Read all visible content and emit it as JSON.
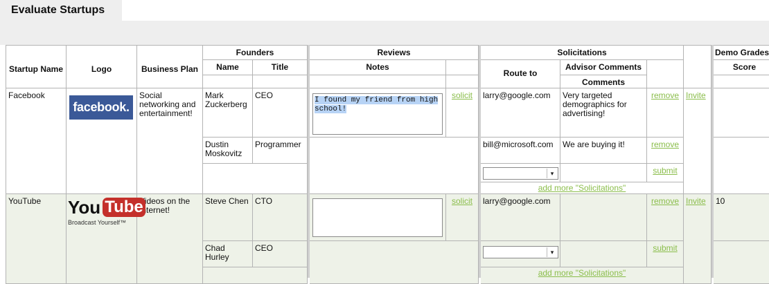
{
  "page": {
    "tab_title": "Evaluate Startups"
  },
  "headers": {
    "startup_name": "Startup Name",
    "logo": "Logo",
    "business_plan": "Business Plan",
    "founders": "Founders",
    "founders_name": "Name",
    "founders_title": "Title",
    "reviews": "Reviews",
    "reviews_notes": "Notes",
    "solicitations": "Solicitations",
    "route_to": "Route to",
    "advisor_comments": "Advisor Comments",
    "comments": "Comments",
    "demo_grades": "Demo Grades",
    "score": "Score"
  },
  "startups": [
    {
      "name": "Facebook",
      "logo": {
        "text": "facebook.",
        "icon": "facebook-logo",
        "color": "#3b5998"
      },
      "business_plan": "Social networking and entertainment!",
      "founders": [
        {
          "name": "Mark Zuckerberg",
          "title": "CEO"
        },
        {
          "name": "Dustin Moskovitz",
          "title": "Programmer"
        }
      ],
      "review_note": "I found my friend from high school!",
      "solicit_label": "solicit",
      "solicitations": [
        {
          "route_to": "larry@google.com",
          "comment": "Very targeted demographics for advertising!",
          "action": "remove"
        },
        {
          "route_to": "bill@microsoft.com",
          "comment": "We are buying it!",
          "action": "remove"
        }
      ],
      "submit_label": "submit",
      "add_more": "add more \"Solicitations\"",
      "invite_label": "Invite",
      "score": ""
    },
    {
      "name": "YouTube",
      "logo": {
        "text_you": "You",
        "text_tube": "Tube",
        "tagline": "Broadcast Yourself™",
        "icon": "youtube-logo",
        "color": "#c4302b"
      },
      "business_plan": "Videos on the Internet!",
      "founders": [
        {
          "name": "Steve Chen",
          "title": "CTO"
        },
        {
          "name": "Chad Hurley",
          "title": "CEO"
        }
      ],
      "review_note": "",
      "solicit_label": "solicit",
      "solicitations": [
        {
          "route_to": "larry@google.com",
          "comment": "",
          "action": "remove"
        }
      ],
      "submit_label": "submit",
      "add_more": "add more \"Solicitations\"",
      "invite_label": "Invite",
      "score": "10"
    }
  ]
}
